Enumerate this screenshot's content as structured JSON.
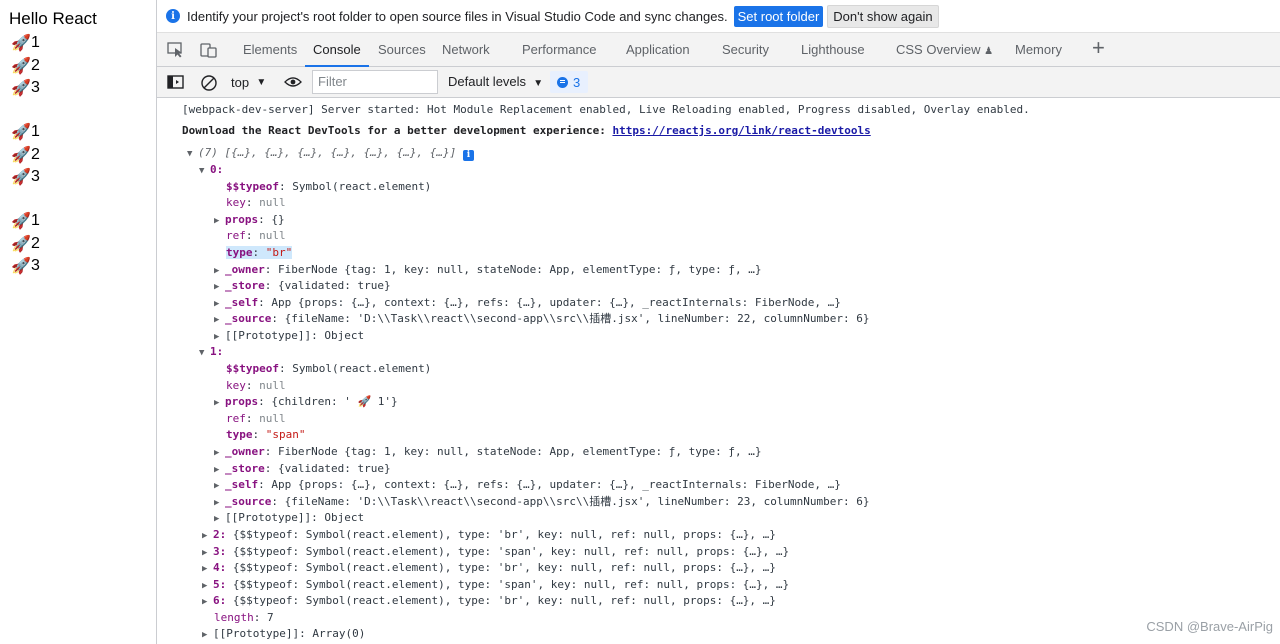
{
  "page": {
    "title": "Hello React",
    "rocket": "🚀",
    "items": [
      "1",
      "2",
      "3",
      "1",
      "2",
      "3",
      "1",
      "2",
      "3"
    ]
  },
  "infobar": {
    "info_icon": "i",
    "message": "Identify your project's root folder to open source files in Visual Studio Code and sync changes.",
    "set_root": "Set root folder",
    "dont_show": "Don't show again"
  },
  "tabs": {
    "elements": "Elements",
    "console": "Console",
    "sources": "Sources",
    "network": "Network",
    "performance": "Performance",
    "application": "Application",
    "security": "Security",
    "lighthouse": "Lighthouse",
    "css_overview": "CSS Overview",
    "css_overview_flag": "♟",
    "memory": "Memory",
    "plus": "+"
  },
  "toolbar": {
    "context": "top",
    "context_arrow": "▼",
    "filter_placeholder": "Filter",
    "levels": "Default levels",
    "levels_arrow": "▼",
    "issues_count": "3"
  },
  "console": {
    "msg1": "[webpack-dev-server] Server started: Hot Module Replacement enabled, Live Reloading enabled, Progress disabled, Overlay enabled.",
    "msg2_text": "Download the React DevTools for a better development experience: ",
    "msg2_link": "https://reactjs.org/link/react-devtools",
    "array_summary": "(7) [{…}, {…}, {…}, {…}, {…}, {…}, {…}]",
    "info_badge": "i",
    "item0": {
      "index": "0:",
      "typeof_key": "$$typeof",
      "typeof_val": "Symbol(react.element)",
      "key_key": "key",
      "key_val": "null",
      "props_key": "props",
      "props_val": "{}",
      "ref_key": "ref",
      "ref_val": "null",
      "type_key": "type",
      "type_val": "\"br\"",
      "owner_key": "_owner",
      "owner_val": "FiberNode {tag: 1, key: null, stateNode: App, elementType: ƒ, type: ƒ, …}",
      "store_key": "_store",
      "store_val": "{validated: true}",
      "self_key": "_self",
      "self_val": "App {props: {…}, context: {…}, refs: {…}, updater: {…}, _reactInternals: FiberNode, …}",
      "source_key": "_source",
      "source_val": "{fileName: 'D:\\\\Task\\\\react\\\\second-app\\\\src\\\\插槽.jsx', lineNumber: 22, columnNumber: 6}",
      "proto": "[[Prototype]]",
      "proto_val": "Object"
    },
    "item1": {
      "index": "1:",
      "typeof_key": "$$typeof",
      "typeof_val": "Symbol(react.element)",
      "key_key": "key",
      "key_val": "null",
      "props_key": "props",
      "props_val": "{children: ' 🚀 1'}",
      "ref_key": "ref",
      "ref_val": "null",
      "type_key": "type",
      "type_val": "\"span\"",
      "owner_key": "_owner",
      "owner_val": "FiberNode {tag: 1, key: null, stateNode: App, elementType: ƒ, type: ƒ, …}",
      "store_key": "_store",
      "store_val": "{validated: true}",
      "self_key": "_self",
      "self_val": "App {props: {…}, context: {…}, refs: {…}, updater: {…}, _reactInternals: FiberNode, …}",
      "source_key": "_source",
      "source_val": "{fileName: 'D:\\\\Task\\\\react\\\\second-app\\\\src\\\\插槽.jsx', lineNumber: 23, columnNumber: 6}",
      "proto": "[[Prototype]]",
      "proto_val": "Object"
    },
    "collapsed": [
      {
        "index": "2:",
        "text": "{$$typeof: Symbol(react.element), type: 'br', key: null, ref: null, props: {…}, …}"
      },
      {
        "index": "3:",
        "text": "{$$typeof: Symbol(react.element), type: 'span', key: null, ref: null, props: {…}, …}"
      },
      {
        "index": "4:",
        "text": "{$$typeof: Symbol(react.element), type: 'br', key: null, ref: null, props: {…}, …}"
      },
      {
        "index": "5:",
        "text": "{$$typeof: Symbol(react.element), type: 'span', key: null, ref: null, props: {…}, …}"
      },
      {
        "index": "6:",
        "text": "{$$typeof: Symbol(react.element), type: 'br', key: null, ref: null, props: {…}, …}"
      }
    ],
    "length_key": "length",
    "length_val": "7",
    "proto": "[[Prototype]]",
    "proto_val": "Array(0)"
  },
  "watermark": "CSDN @Brave-AirPig",
  "colors": {
    "accent": "#1a73e8",
    "key_purple": "#881280",
    "string_red": "#c41a16",
    "highlight": "#cfe8fc"
  },
  "icons": {
    "inspect": "cursor-select-icon",
    "device": "device-toggle-icon",
    "sidebar": "sidebar-toggle-icon",
    "clear": "clear-console-icon",
    "eye": "live-expression-eye-icon",
    "info": "info-icon",
    "rocket": "rocket-emoji-icon"
  }
}
